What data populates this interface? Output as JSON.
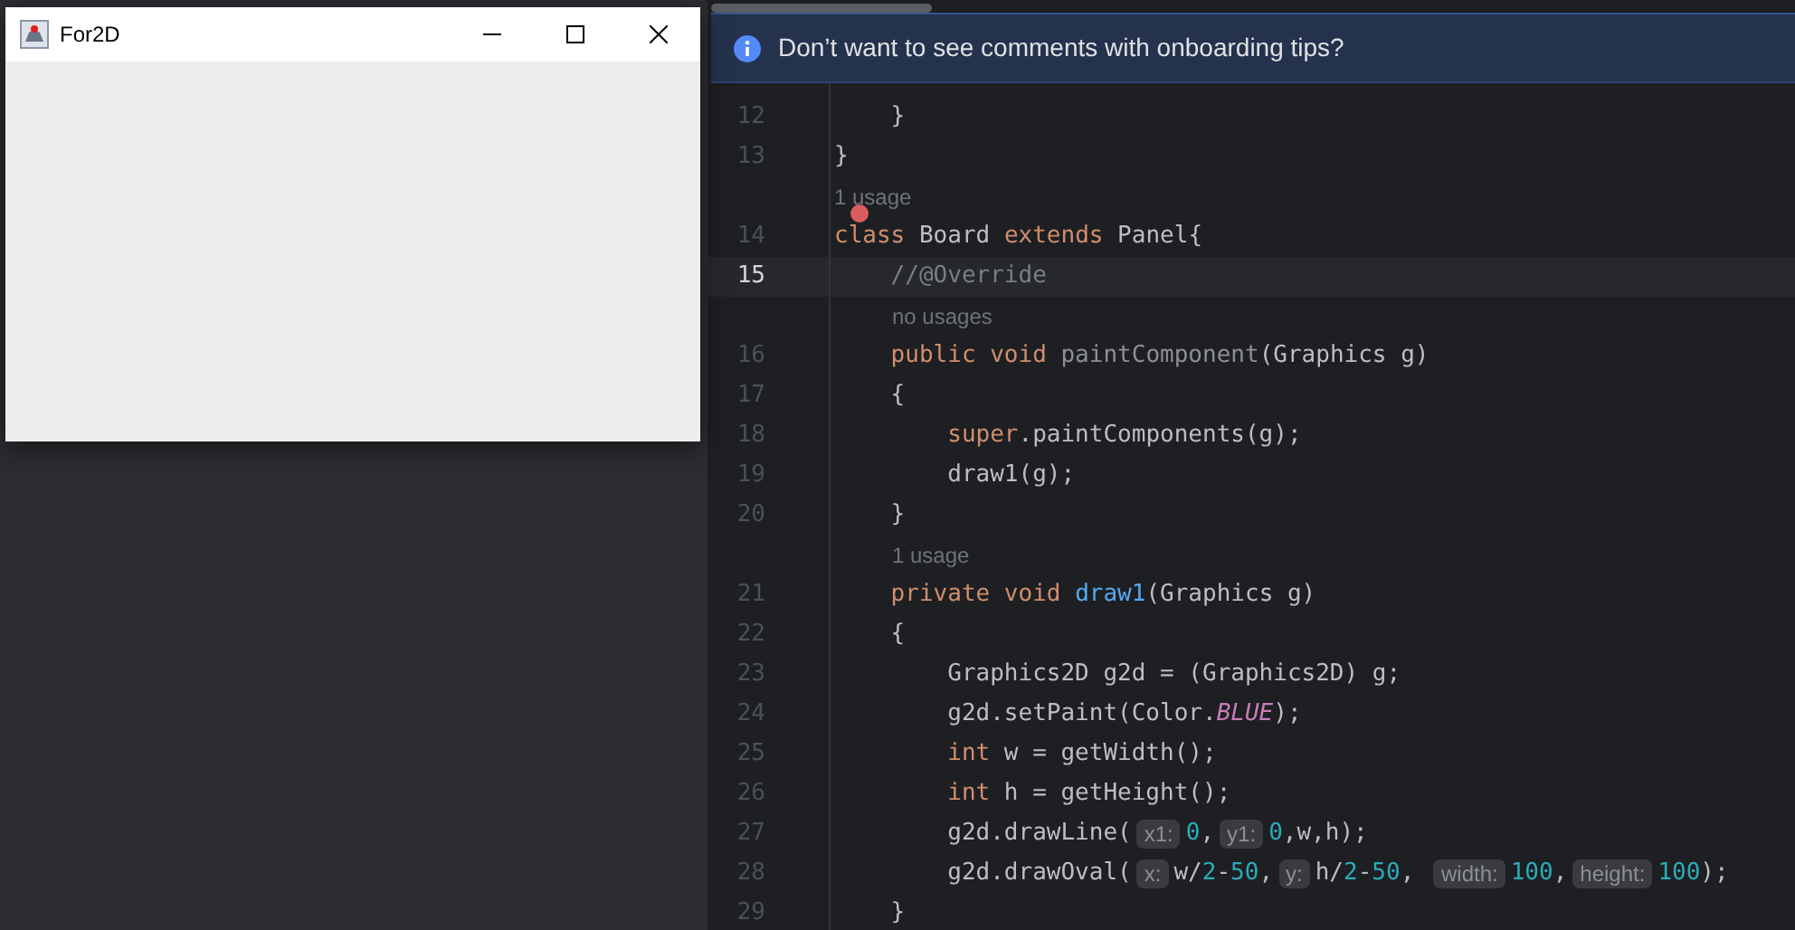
{
  "app_window": {
    "title": "For2D"
  },
  "banner": {
    "text": "Don’t want to see comments with onboarding tips?"
  },
  "editor_lines": [
    {
      "number": "12",
      "selected": false,
      "error": false,
      "tokens": [
        {
          "kind": "plain",
          "s": "    }"
        }
      ]
    },
    {
      "number": "13",
      "selected": false,
      "error": false,
      "tokens": [
        {
          "kind": "plain",
          "s": "}"
        }
      ]
    },
    {
      "number": "14",
      "selected": false,
      "error": true,
      "usage_hint": "1 usage",
      "tokens": [
        {
          "kind": "keyword",
          "s": "class"
        },
        {
          "kind": "plain",
          "s": " Board "
        },
        {
          "kind": "keyword",
          "s": "extends"
        },
        {
          "kind": "plain",
          "s": " Panel{"
        }
      ]
    },
    {
      "number": "15",
      "selected": true,
      "error": false,
      "tokens": [
        {
          "kind": "comment",
          "s": "    //@Override"
        }
      ]
    },
    {
      "number": "16",
      "selected": false,
      "error": false,
      "usage_hint": "no usages",
      "tokens": [
        {
          "kind": "keyword",
          "s": "    public void "
        },
        {
          "kind": "unused",
          "s": "paintComponent"
        },
        {
          "kind": "plain",
          "s": "(Graphics g)"
        }
      ]
    },
    {
      "number": "17",
      "selected": false,
      "error": false,
      "tokens": [
        {
          "kind": "plain",
          "s": "    {"
        }
      ]
    },
    {
      "number": "18",
      "selected": false,
      "error": false,
      "tokens": [
        {
          "kind": "keyword",
          "s": "        super"
        },
        {
          "kind": "plain",
          "s": ".paintComponents(g);"
        }
      ]
    },
    {
      "number": "19",
      "selected": false,
      "error": false,
      "tokens": [
        {
          "kind": "plain",
          "s": "        draw1(g);"
        }
      ]
    },
    {
      "number": "20",
      "selected": false,
      "error": false,
      "tokens": [
        {
          "kind": "plain",
          "s": "    }"
        }
      ]
    },
    {
      "number": "21",
      "selected": false,
      "error": false,
      "usage_hint": "1 usage",
      "tokens": [
        {
          "kind": "keyword",
          "s": "    private void "
        },
        {
          "kind": "declaration",
          "s": "draw1"
        },
        {
          "kind": "plain",
          "s": "(Graphics g)"
        }
      ]
    },
    {
      "number": "22",
      "selected": false,
      "error": false,
      "tokens": [
        {
          "kind": "plain",
          "s": "    {"
        }
      ]
    },
    {
      "number": "23",
      "selected": false,
      "error": false,
      "tokens": [
        {
          "kind": "plain",
          "s": "        Graphics2D g2d = (Graphics2D) g;"
        }
      ]
    },
    {
      "number": "24",
      "selected": false,
      "error": false,
      "tokens": [
        {
          "kind": "plain",
          "s": "        g2d.setPaint(Color."
        },
        {
          "kind": "constant",
          "s": "BLUE"
        },
        {
          "kind": "plain",
          "s": ");"
        }
      ]
    },
    {
      "number": "25",
      "selected": false,
      "error": false,
      "tokens": [
        {
          "kind": "keyword",
          "s": "        int"
        },
        {
          "kind": "plain",
          "s": " w = getWidth();"
        }
      ]
    },
    {
      "number": "26",
      "selected": false,
      "error": false,
      "tokens": [
        {
          "kind": "keyword",
          "s": "        int"
        },
        {
          "kind": "plain",
          "s": " h = getHeight();"
        }
      ]
    },
    {
      "number": "27",
      "selected": false,
      "error": false,
      "tokens": [
        {
          "kind": "plain",
          "s": "        g2d.drawLine("
        },
        {
          "kind": "inlay",
          "s": "x1:"
        },
        {
          "kind": "number",
          "s": "0"
        },
        {
          "kind": "plain",
          "s": ","
        },
        {
          "kind": "inlay",
          "s": "y1:"
        },
        {
          "kind": "number",
          "s": "0"
        },
        {
          "kind": "plain",
          "s": ",w,h);"
        }
      ]
    },
    {
      "number": "28",
      "selected": false,
      "error": false,
      "tokens": [
        {
          "kind": "plain",
          "s": "        g2d.drawOval("
        },
        {
          "kind": "inlay",
          "s": "x:"
        },
        {
          "kind": "plain",
          "s": "w/"
        },
        {
          "kind": "number",
          "s": "2"
        },
        {
          "kind": "plain",
          "s": "-"
        },
        {
          "kind": "number",
          "s": "50"
        },
        {
          "kind": "plain",
          "s": ","
        },
        {
          "kind": "inlay",
          "s": "y:"
        },
        {
          "kind": "plain",
          "s": "h/"
        },
        {
          "kind": "number",
          "s": "2"
        },
        {
          "kind": "plain",
          "s": "-"
        },
        {
          "kind": "number",
          "s": "50"
        },
        {
          "kind": "plain",
          "s": ", "
        },
        {
          "kind": "inlay",
          "s": "width:"
        },
        {
          "kind": "number",
          "s": "100"
        },
        {
          "kind": "plain",
          "s": ","
        },
        {
          "kind": "inlay",
          "s": "height:"
        },
        {
          "kind": "number",
          "s": "100"
        },
        {
          "kind": "plain",
          "s": ");"
        }
      ]
    },
    {
      "number": "29",
      "selected": false,
      "error": false,
      "tokens": [
        {
          "kind": "plain",
          "s": "    }"
        }
      ]
    }
  ]
}
